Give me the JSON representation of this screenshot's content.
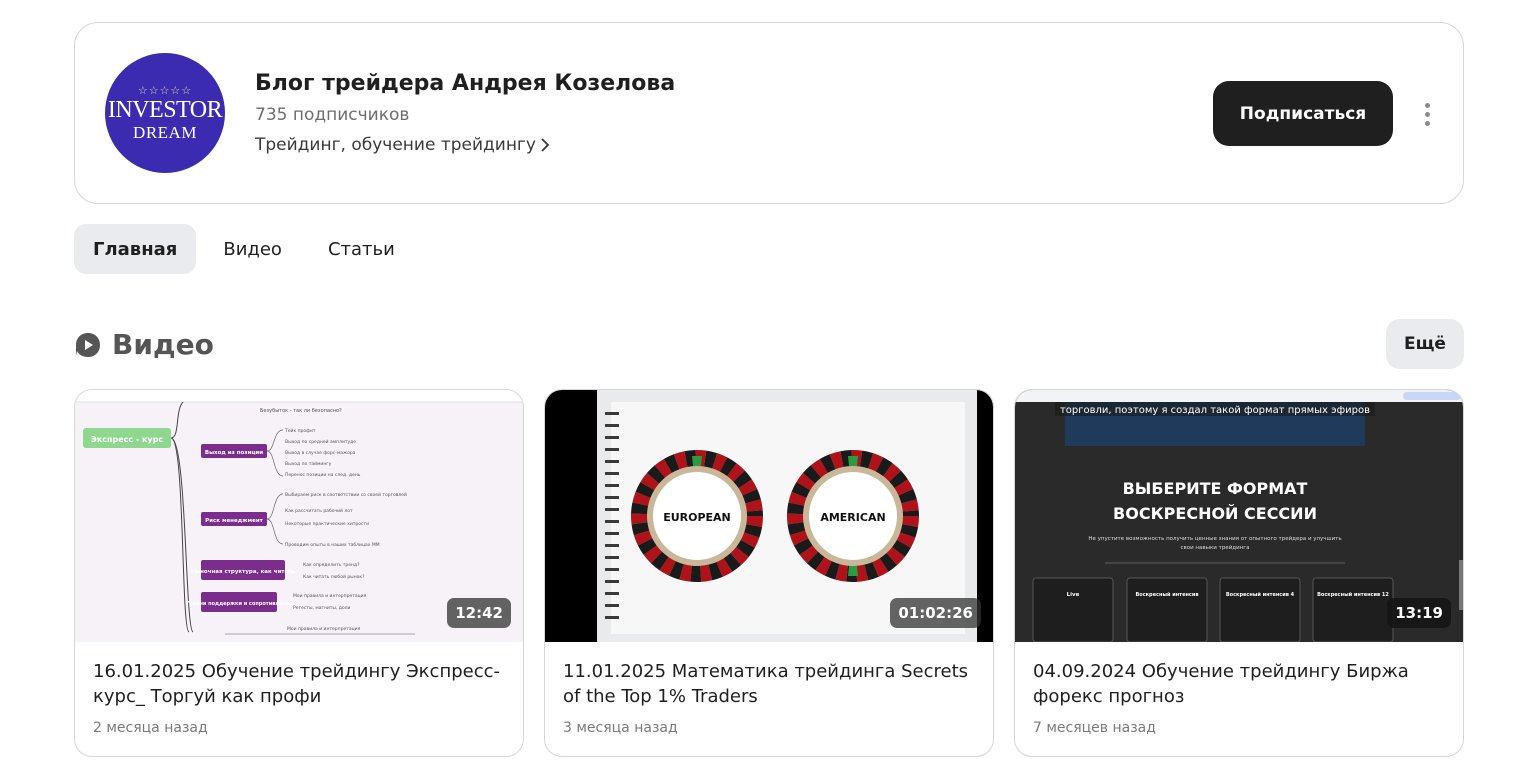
{
  "channel": {
    "avatar": {
      "stars": "☆☆☆☆☆",
      "line1": "INVESTOR",
      "line2": "DREAM",
      "background": "#3a2bb0"
    },
    "name": "Блог трейдера Андрея Козелова",
    "subscribers": "735 подписчиков",
    "topic": "Трейдинг, обучение трейдингу",
    "subscribe_label": "Подписаться"
  },
  "tabs": [
    {
      "label": "Главная",
      "active": true
    },
    {
      "label": "Видео",
      "active": false
    },
    {
      "label": "Статьи",
      "active": false
    }
  ],
  "videos_section": {
    "title": "Видео",
    "more_label": "Ещё",
    "items": [
      {
        "title": "16.01.2025 Обучение трейдингу Экспресс-курс_ Торгуй как профи",
        "date": "2 месяца назад",
        "duration": "12:42",
        "thumb": {
          "root_label": "Экспресс - курс",
          "top_note": "Безубыток - так ли безопасно?",
          "nodes": [
            {
              "label": "Выход из позиции",
              "items": [
                "Тейк профит",
                "Выход по средней амплитуде",
                "Выход в случае форс-мажора",
                "Выход по таймингу",
                "Перенос позиции на след. день"
              ]
            },
            {
              "label": "Риск менеджмент",
              "items": [
                "Выбираем риск в соответствии со своей торговлей",
                "Как рассчитать рабочий лот",
                "Некоторые практические хитрости",
                "Проводим опыты в наших таблицах ММ"
              ]
            },
            {
              "label": "Рыночная структура, как читать",
              "items": [
                "Как определить тренд?",
                "Как читать любой рынок?"
              ]
            },
            {
              "label": "Уровни поддержки и сопротивления",
              "items": [
                "Мои правила и интерпретация",
                "Ретесты, магниты, доли"
              ]
            }
          ],
          "bottom_note": "Мои правила и интерпретация"
        }
      },
      {
        "title": "11.01.2025 Математика трейдинга Secrets of the Top 1% Traders",
        "date": "3 месяца назад",
        "duration": "01:02:26",
        "thumb": {
          "left_wheel": "EUROPEAN",
          "right_wheel": "AMERICAN"
        }
      },
      {
        "title": "04.09.2024 Обучение трейдингу Биржа форекс прогноз",
        "date": "7 месяцев назад",
        "duration": "13:19",
        "thumb": {
          "top_text": "торговли, поэтому я создал такой формат прямых эфиров",
          "heading_line1": "ВЫБЕРИТЕ ФОРМАТ",
          "heading_line2": "ВОСКРЕСНОЙ СЕССИИ",
          "subtext_line1": "Не упустите возможность получить ценные знания от опытного трейдера и улучшить",
          "subtext_line2": "свои навыки трейдинга",
          "plans": [
            "Live",
            "Воскресный интенсив",
            "Воскресный интенсив 4",
            "Воскресный интенсив 12"
          ]
        }
      }
    ]
  }
}
